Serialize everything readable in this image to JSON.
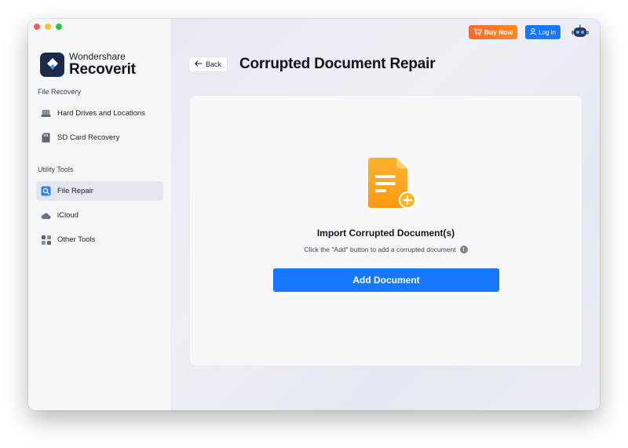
{
  "app": {
    "brand_top": "Wondershare",
    "brand_bottom": "Recoverit"
  },
  "sidebar": {
    "sections": [
      {
        "title": "File Recovery",
        "items": [
          {
            "label": "Hard Drives and Locations",
            "icon": "hard-drive-icon",
            "active": false
          },
          {
            "label": "SD Card Recovery",
            "icon": "sd-card-icon",
            "active": false
          }
        ]
      },
      {
        "title": "Utility Tools",
        "items": [
          {
            "label": "File Repair",
            "icon": "file-repair-icon",
            "active": true
          },
          {
            "label": "iCloud",
            "icon": "cloud-icon",
            "active": false
          },
          {
            "label": "Other Tools",
            "icon": "grid-icon",
            "active": false
          }
        ]
      }
    ]
  },
  "topbar": {
    "buy_label": "Buy Now",
    "login_label": "Log in"
  },
  "header": {
    "back_label": "Back",
    "title": "Corrupted Document Repair"
  },
  "main": {
    "import_title": "Import Corrupted Document(s)",
    "hint": "Click the \"Add\" button to add a corrupted document",
    "add_button": "Add Document"
  },
  "colors": {
    "accent": "#1677ff",
    "buy": "#ff7a22",
    "doc_icon": "#ffa51f",
    "brand_logo": "#1c2b4a"
  }
}
